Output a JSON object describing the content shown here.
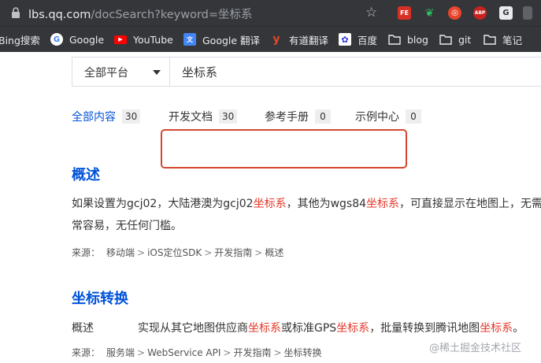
{
  "browser": {
    "url_host": "lbs.qq.com",
    "url_path": "/docSearch?keyword=坐标系",
    "extensions": [
      "FE",
      "ABP"
    ],
    "bookmarks": [
      {
        "label": "Bing搜索",
        "icon": "bing-icon"
      },
      {
        "label": "Google",
        "icon": "google-icon"
      },
      {
        "label": "YouTube",
        "icon": "youtube-icon"
      },
      {
        "label": "Google 翻译",
        "icon": "translate-icon"
      },
      {
        "label": "有道翻译",
        "icon": "youdao-icon"
      },
      {
        "label": "百度",
        "icon": "baidu-icon"
      },
      {
        "label": "blog",
        "icon": "folder-icon"
      },
      {
        "label": "git",
        "icon": "folder-icon"
      },
      {
        "label": "笔记",
        "icon": "folder-icon"
      }
    ]
  },
  "search": {
    "platform": "全部平台",
    "keyword": "坐标系"
  },
  "tabs": [
    {
      "label": "全部内容",
      "count": "30",
      "active": true
    },
    {
      "label": "开发文档",
      "count": "30",
      "active": false
    },
    {
      "label": "参考手册",
      "count": "0",
      "active": false
    },
    {
      "label": "示例中心",
      "count": "0",
      "active": false
    }
  ],
  "results": [
    {
      "title": "概述",
      "line1_a": "如果设置为gcj02，大陆港澳为gcj02",
      "line1_hl1": "坐标系",
      "line1_b": "，其他为wgs84",
      "line1_hl2": "坐标系",
      "line1_c": "，可直接显示在地图上，无需用",
      "line2": "常容易，无任何门槛。",
      "source_label": "来源：",
      "path": [
        "移动端",
        "iOS定位SDK",
        "开发指南",
        "概述"
      ]
    },
    {
      "title": "坐标转换",
      "label": "概述",
      "text_a": "实现从其它地图供应商",
      "hl1": "坐标系",
      "text_b": "或标准GPS",
      "hl2": "坐标系",
      "text_c": "，批量转换到腾讯地图",
      "hl3": "坐标系",
      "text_d": "。",
      "source_label": "来源：",
      "path": [
        "服务端",
        "WebService API",
        "开发指南",
        "坐标转换"
      ]
    }
  ],
  "watermark": "@稀土掘金技术社区",
  "colors": {
    "accent": "#0052d9",
    "highlight": "#e3382a",
    "annotation": "#d6452f"
  }
}
